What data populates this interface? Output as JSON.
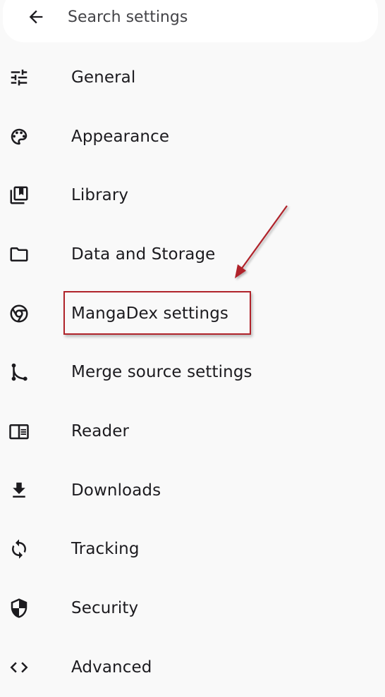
{
  "search": {
    "placeholder": "Search settings",
    "value": ""
  },
  "menu": {
    "items": [
      {
        "id": "general",
        "label": "General",
        "icon": "tune-icon"
      },
      {
        "id": "appearance",
        "label": "Appearance",
        "icon": "palette-icon"
      },
      {
        "id": "library",
        "label": "Library",
        "icon": "library-icon"
      },
      {
        "id": "data-storage",
        "label": "Data and Storage",
        "icon": "folder-icon"
      },
      {
        "id": "mangadex",
        "label": "MangaDex settings",
        "icon": "browser-icon"
      },
      {
        "id": "merge-source",
        "label": "Merge source settings",
        "icon": "merge-icon"
      },
      {
        "id": "reader",
        "label": "Reader",
        "icon": "reader-icon"
      },
      {
        "id": "downloads",
        "label": "Downloads",
        "icon": "download-icon"
      },
      {
        "id": "tracking",
        "label": "Tracking",
        "icon": "sync-icon"
      },
      {
        "id": "security",
        "label": "Security",
        "icon": "shield-icon"
      },
      {
        "id": "advanced",
        "label": "Advanced",
        "icon": "code-icon"
      }
    ]
  },
  "annotation": {
    "highlighted_item": "MangaDex settings",
    "color": "#b0232a"
  }
}
